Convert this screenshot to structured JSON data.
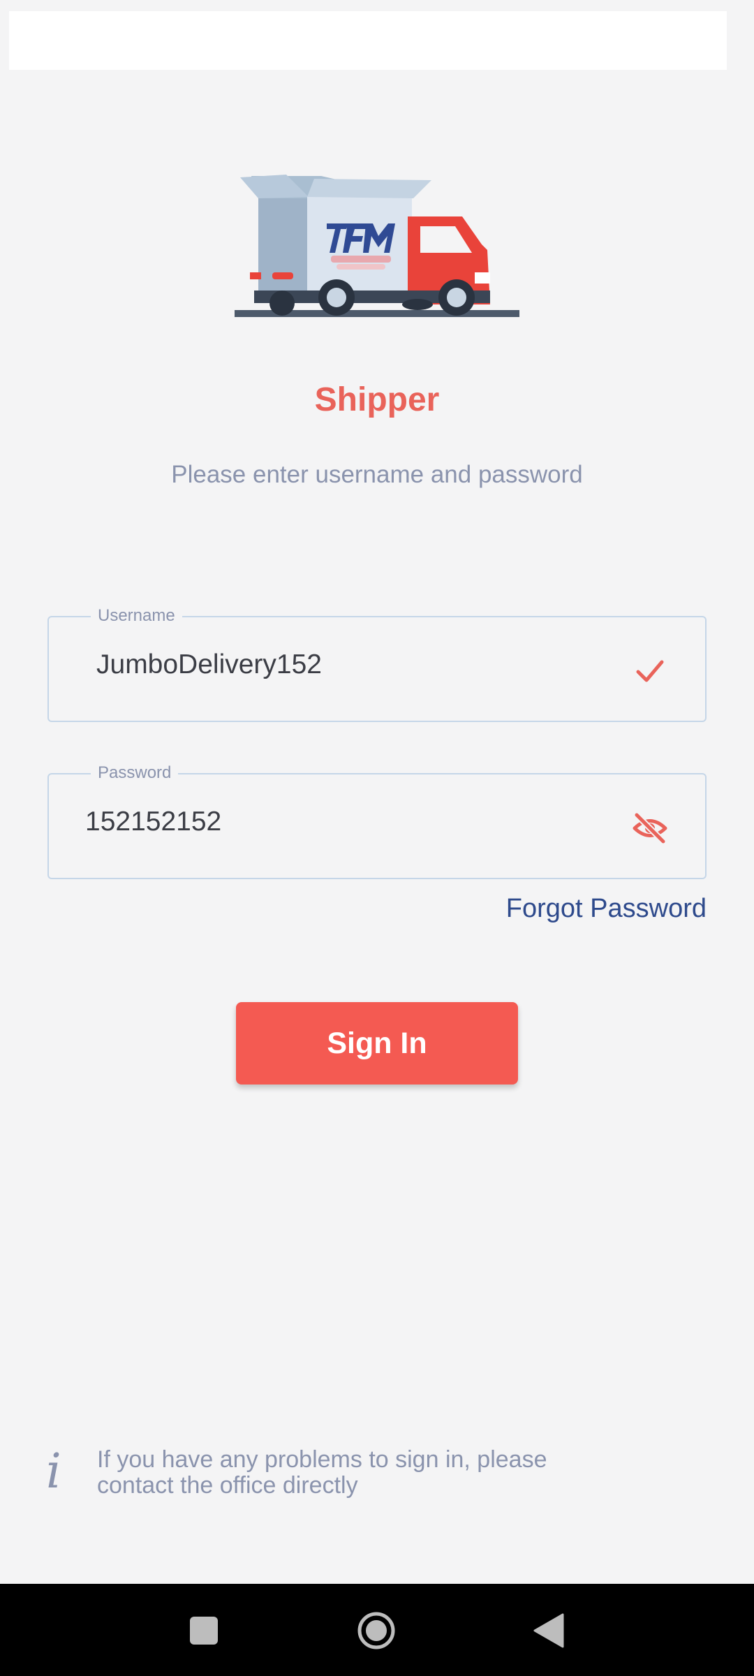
{
  "app": {
    "title": "Shipper",
    "subtitle": "Please enter username and password",
    "logo_icon": "delivery-truck-logo"
  },
  "form": {
    "username": {
      "label": "Username",
      "value": "JumboDelivery152",
      "status_icon": "checkmark-icon"
    },
    "password": {
      "label": "Password",
      "value": "152152152",
      "toggle_icon": "eye-off-icon"
    },
    "forgot_label": "Forgot Password",
    "signin_label": "Sign In"
  },
  "info": {
    "icon": "info-icon",
    "text": "If you have any problems to sign in, please contact the office directly"
  },
  "navigation": {
    "recent_icon": "recent-apps-icon",
    "home_icon": "home-icon",
    "back_icon": "back-icon"
  },
  "colors": {
    "accent": "#f45a52",
    "title": "#e9635a",
    "link": "#2e4a8c",
    "muted": "#8a93ad",
    "background": "#f4f4f5"
  }
}
